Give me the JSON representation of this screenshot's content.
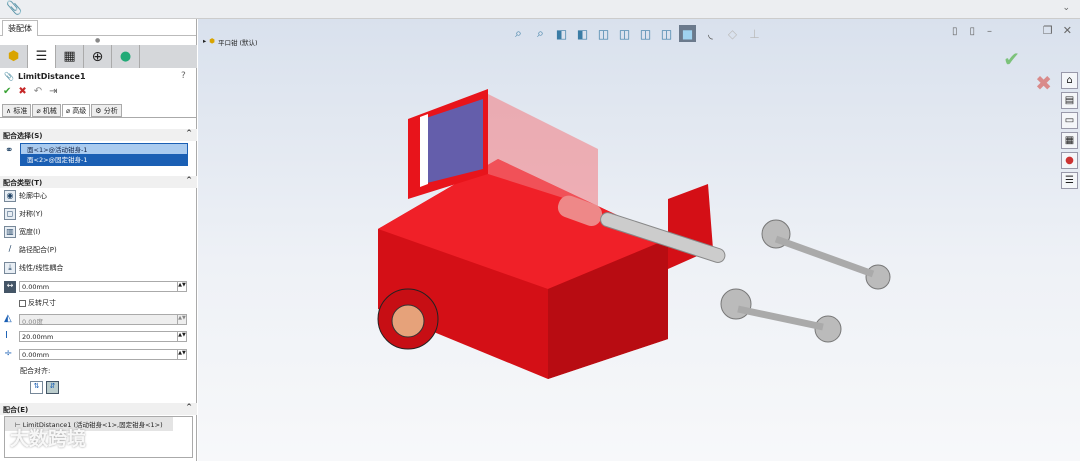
{
  "panel": {
    "tab": "装配体",
    "feature_name": "LimitDistance1",
    "subtabs": [
      "标准",
      "机械",
      "高级",
      "分析"
    ],
    "mate_selections": {
      "title": "配合选择(S)",
      "items": [
        "面<1>@活动钳身-1",
        "面<2>@固定钳身-1"
      ]
    },
    "mate_types": {
      "title": "配合类型(T)",
      "items": [
        "轮廓中心",
        "对称(Y)",
        "宽度(I)",
        "路径配合(P)",
        "线性/线性耦合"
      ]
    },
    "distance": "0.00mm",
    "flip_label": "反转尺寸",
    "angle": "0.00度",
    "max": "20.00mm",
    "min": "0.00mm",
    "alignment_label": "配合对齐:",
    "mates": {
      "title": "配合(E)",
      "item": "LimitDistance1 (活动钳身<1>,固定钳身<1>)"
    }
  },
  "tree": {
    "root": "平口钳 (默认)"
  },
  "watermark": "大数跨境",
  "colors": {
    "model": "#e8141b",
    "accent": "#1a5fb4",
    "ok": "#3aa335",
    "cancel": "#c62828"
  }
}
